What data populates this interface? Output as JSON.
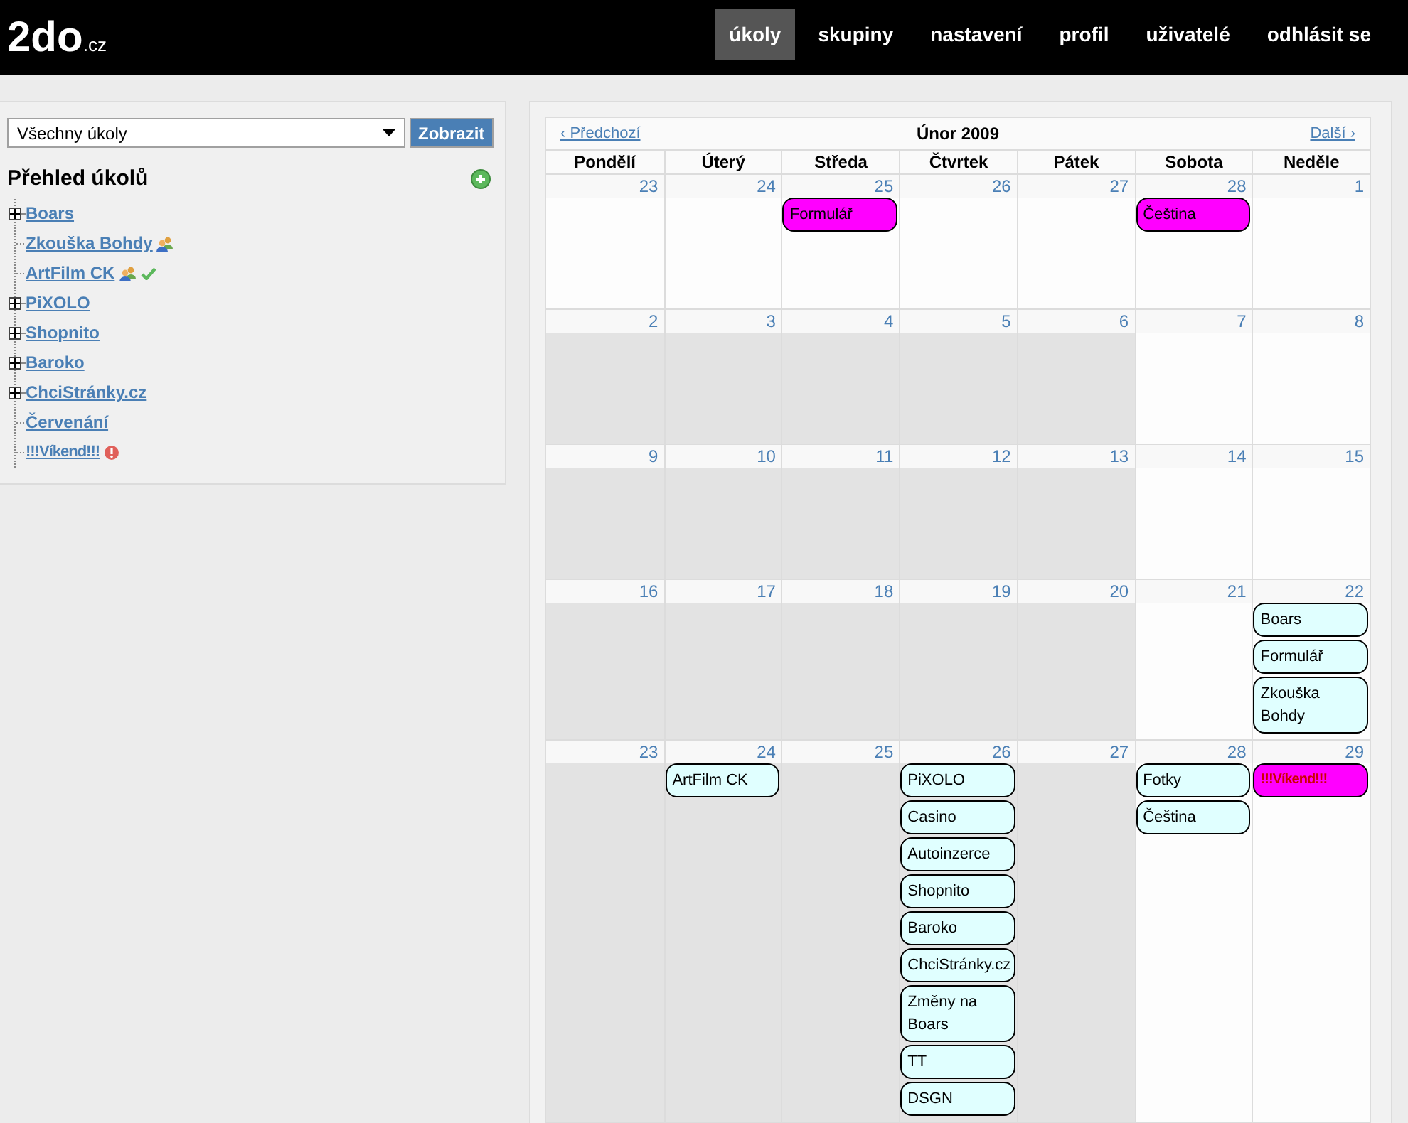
{
  "logo": {
    "main": "2do",
    "suffix": ".cz"
  },
  "nav": [
    {
      "label": "úkoly",
      "selected": true
    },
    {
      "label": "skupiny",
      "selected": false
    },
    {
      "label": "nastavení",
      "selected": false
    },
    {
      "label": "profil",
      "selected": false
    },
    {
      "label": "uživatelé",
      "selected": false
    },
    {
      "label": "odhlásit se",
      "selected": false
    }
  ],
  "filter": {
    "value": "Všechny úkoly",
    "button": "Zobrazit"
  },
  "overview": {
    "title": "Přehled úkolů",
    "items": [
      {
        "label": "Boars",
        "expandable": true,
        "shared": false,
        "done": false,
        "urgent": false
      },
      {
        "label": "Zkouška Bohdy",
        "expandable": false,
        "shared": true,
        "done": false,
        "urgent": false
      },
      {
        "label": "ArtFilm CK",
        "expandable": false,
        "shared": true,
        "done": true,
        "urgent": false
      },
      {
        "label": "PiXOLO",
        "expandable": true,
        "shared": false,
        "done": false,
        "urgent": false
      },
      {
        "label": "Shopnito",
        "expandable": true,
        "shared": false,
        "done": false,
        "urgent": false
      },
      {
        "label": "Baroko",
        "expandable": true,
        "shared": false,
        "done": false,
        "urgent": false
      },
      {
        "label": "ChciStránky.cz",
        "expandable": true,
        "shared": false,
        "done": false,
        "urgent": false
      },
      {
        "label": "Červenání",
        "expandable": false,
        "shared": false,
        "done": false,
        "urgent": false
      },
      {
        "label": "!!!Víkend!!!",
        "expandable": false,
        "shared": false,
        "done": false,
        "urgent": true
      }
    ]
  },
  "calendar": {
    "prev": "‹ Předchozí",
    "title": "Únor 2009",
    "next": "Další ›",
    "weekdays": [
      "Pondělí",
      "Úterý",
      "Středa",
      "Čtvrtek",
      "Pátek",
      "Sobota",
      "Neděle"
    ],
    "weeks": [
      {
        "days": [
          {
            "day": "23",
            "shaded": false
          },
          {
            "day": "24",
            "shaded": false
          },
          {
            "day": "25",
            "shaded": false,
            "events": [
              {
                "label": "Formulář",
                "color": "#ff00ff",
                "urgent": false
              }
            ]
          },
          {
            "day": "26",
            "shaded": false
          },
          {
            "day": "27",
            "shaded": false
          },
          {
            "day": "28",
            "shaded": false,
            "events": [
              {
                "label": "Čeština",
                "color": "#ff00ff",
                "urgent": false
              }
            ]
          },
          {
            "day": "1",
            "shaded": false
          }
        ]
      },
      {
        "days": [
          {
            "day": "2",
            "shaded": true
          },
          {
            "day": "3",
            "shaded": true
          },
          {
            "day": "4",
            "shaded": true
          },
          {
            "day": "5",
            "shaded": true
          },
          {
            "day": "6",
            "shaded": true
          },
          {
            "day": "7",
            "shaded": false
          },
          {
            "day": "8",
            "shaded": false
          }
        ]
      },
      {
        "days": [
          {
            "day": "9",
            "shaded": true
          },
          {
            "day": "10",
            "shaded": true
          },
          {
            "day": "11",
            "shaded": true
          },
          {
            "day": "12",
            "shaded": true
          },
          {
            "day": "13",
            "shaded": true
          },
          {
            "day": "14",
            "shaded": false
          },
          {
            "day": "15",
            "shaded": false
          }
        ]
      },
      {
        "days": [
          {
            "day": "16",
            "shaded": true
          },
          {
            "day": "17",
            "shaded": true
          },
          {
            "day": "18",
            "shaded": true
          },
          {
            "day": "19",
            "shaded": true
          },
          {
            "day": "20",
            "shaded": true
          },
          {
            "day": "21",
            "shaded": false
          },
          {
            "day": "22",
            "shaded": false,
            "events": [
              {
                "label": "Boars",
                "color": "#e0ffff",
                "urgent": false
              },
              {
                "label": "Formulář",
                "color": "#e0ffff",
                "urgent": false
              },
              {
                "label": "Zkouška Bohdy",
                "color": "#e0ffff",
                "urgent": false
              }
            ]
          }
        ]
      },
      {
        "days": [
          {
            "day": "23",
            "shaded": true
          },
          {
            "day": "24",
            "shaded": true,
            "events": [
              {
                "label": "ArtFilm CK",
                "color": "#e0ffff",
                "urgent": false
              }
            ]
          },
          {
            "day": "25",
            "shaded": true
          },
          {
            "day": "26",
            "shaded": true,
            "events": [
              {
                "label": "PiXOLO",
                "color": "#e0ffff",
                "urgent": false
              },
              {
                "label": "Casino",
                "color": "#e0ffff",
                "urgent": false
              },
              {
                "label": "Autoinzerce",
                "color": "#e0ffff",
                "urgent": false
              },
              {
                "label": "Shopnito",
                "color": "#e0ffff",
                "urgent": false
              },
              {
                "label": "Baroko",
                "color": "#e0ffff",
                "urgent": false
              },
              {
                "label": "ChciStránky.cz",
                "color": "#e0ffff",
                "urgent": false
              },
              {
                "label": "Změny na Boars",
                "color": "#e0ffff",
                "urgent": false
              },
              {
                "label": "TT",
                "color": "#e0ffff",
                "urgent": false
              },
              {
                "label": "DSGN",
                "color": "#e0ffff",
                "urgent": false
              }
            ]
          },
          {
            "day": "27",
            "shaded": true
          },
          {
            "day": "28",
            "shaded": false,
            "events": [
              {
                "label": "Fotky",
                "color": "#e0ffff",
                "urgent": false
              },
              {
                "label": "Čeština",
                "color": "#e0ffff",
                "urgent": false
              }
            ]
          },
          {
            "day": "29",
            "shaded": false,
            "events": [
              {
                "label": "!!!Víkend!!!",
                "color": "#ff00ff",
                "urgent": true
              }
            ]
          }
        ]
      }
    ]
  }
}
